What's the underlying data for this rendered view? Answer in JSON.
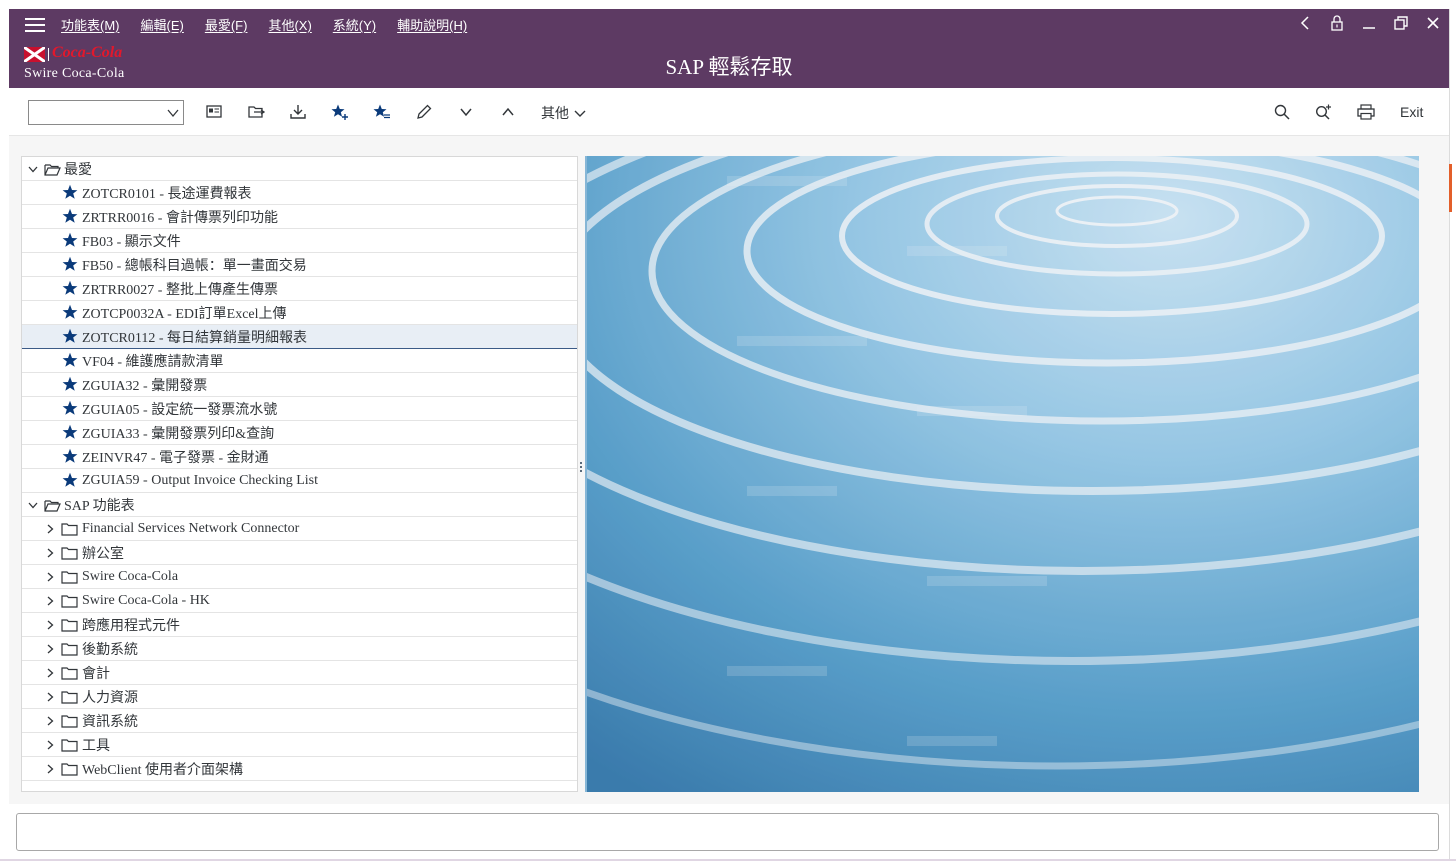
{
  "menubar": {
    "items": [
      "功能表(M)",
      "編輯(E)",
      "最愛(F)",
      "其他(X)",
      "系統(Y)",
      "輔助說明(H)"
    ]
  },
  "titlebar": {
    "title": "SAP 輕鬆存取",
    "logo_script": "Coca-Cola",
    "logo_name": "Swire Coca-Cola"
  },
  "toolbar": {
    "more_label": "其他",
    "exit_label": "Exit",
    "transaction_value": ""
  },
  "tree": {
    "favorites_label": "最愛",
    "favorites": [
      {
        "label": "ZOTCR0101 - 長途運費報表",
        "selected": false
      },
      {
        "label": "ZRTRR0016 - 會計傳票列印功能",
        "selected": false
      },
      {
        "label": "FB03 - 顯示文件",
        "selected": false
      },
      {
        "label": "FB50 - 總帳科目過帳：單一畫面交易",
        "selected": false
      },
      {
        "label": "ZRTRR0027 - 整批上傳產生傳票",
        "selected": false
      },
      {
        "label": "ZOTCP0032A - EDI訂單Excel上傳",
        "selected": false
      },
      {
        "label": "ZOTCR0112 - 每日結算銷量明細報表",
        "selected": true
      },
      {
        "label": "VF04 - 維護應請款清單",
        "selected": false
      },
      {
        "label": "ZGUIA32 - 彙開發票",
        "selected": false
      },
      {
        "label": "ZGUIA05 - 設定統一發票流水號",
        "selected": false
      },
      {
        "label": "ZGUIA33 - 彙開發票列印&查詢",
        "selected": false
      },
      {
        "label": "ZEINVR47 - 電子發票 - 金財通",
        "selected": false
      },
      {
        "label": "ZGUIA59 - Output Invoice Checking List",
        "selected": false
      }
    ],
    "sap_menu_label": "SAP 功能表",
    "sap_menu": [
      "Financial Services Network Connector",
      "辦公室",
      "Swire Coca-Cola",
      "Swire Coca-Cola - HK",
      "跨應用程式元件",
      "後勤系統",
      "會計",
      "人力資源",
      "資訊系統",
      "工具",
      "WebClient 使用者介面架構"
    ]
  },
  "colors": {
    "shell": "#5d3a63",
    "accent_blue": "#0a3a7a",
    "selection": "#e8eef5"
  },
  "icons": [
    "menu-icon",
    "back-icon",
    "lock-icon",
    "minimize-icon",
    "restore-icon",
    "close-icon",
    "star-icon",
    "folder-icon",
    "search-icon",
    "print-icon"
  ]
}
